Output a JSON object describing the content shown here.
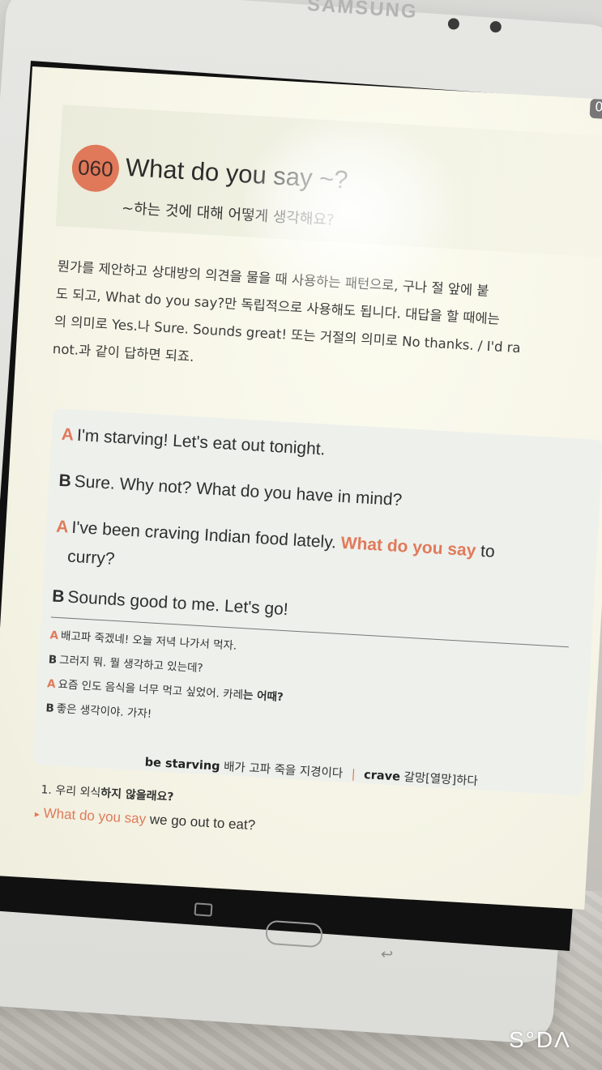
{
  "device": {
    "brand": "SAMSUNG"
  },
  "lesson": {
    "number": "060",
    "title_en": "What do you say ~?",
    "title_ko": "~하는 것에 대해 어떻게 생각해요?",
    "corner": "0"
  },
  "intro_lines": [
    "뭔가를 제안하고 상대방의 의견을 물을 때 사용하는 패턴으로, 구나 절 앞에 붙",
    "도 되고, What do you say?만 독립적으로 사용해도 됩니다. 대답을 할 때에는",
    "의 의미로 Yes.나 Sure. Sounds great! 또는 거절의 의미로 No thanks. / I'd ra",
    "not.과 같이 답하면 되죠."
  ],
  "dialog": {
    "lines": [
      {
        "speaker": "A",
        "text": "I'm starving! Let's eat out tonight."
      },
      {
        "speaker": "B",
        "text": "Sure. Why not? What do you have in mind?"
      },
      {
        "speaker": "A",
        "text_before": "I've been craving Indian food lately. ",
        "highlight": "What do you say",
        "text_after": " to"
      },
      {
        "speaker": "",
        "text": "curry?"
      },
      {
        "speaker": "B",
        "text": "Sounds good to me. Let's go!"
      }
    ],
    "translation": [
      {
        "speaker": "A",
        "text": "배고파 죽겠네! 오늘 저녁 나가서 먹자."
      },
      {
        "speaker": "B",
        "text": "그러지 뭐. 뭘 생각하고 있는데?"
      },
      {
        "speaker": "A",
        "text_before": "요즘 인도 음식을 너무 먹고 싶었어. 카레",
        "bold": "는 어때?"
      },
      {
        "speaker": "B",
        "text": "좋은 생각이야. 가자!"
      }
    ]
  },
  "vocab": {
    "term1": "be starving",
    "def1": "배가 고파 죽을 지경이다",
    "separator": "|",
    "term2": "crave",
    "def2": "갈망[열망]하다"
  },
  "exercise": {
    "q1_prefix": "1. 우리 외식",
    "q1_bold": "하지 않을래요?",
    "answer_marker": "▸",
    "answer_highlight": "What do you say",
    "answer_rest": " we go out to eat?"
  },
  "watermark": "S°DΛ",
  "colors": {
    "accent": "#e07a5a",
    "page": "#f6f5e7",
    "dialog_bg": "#eef0ec"
  }
}
